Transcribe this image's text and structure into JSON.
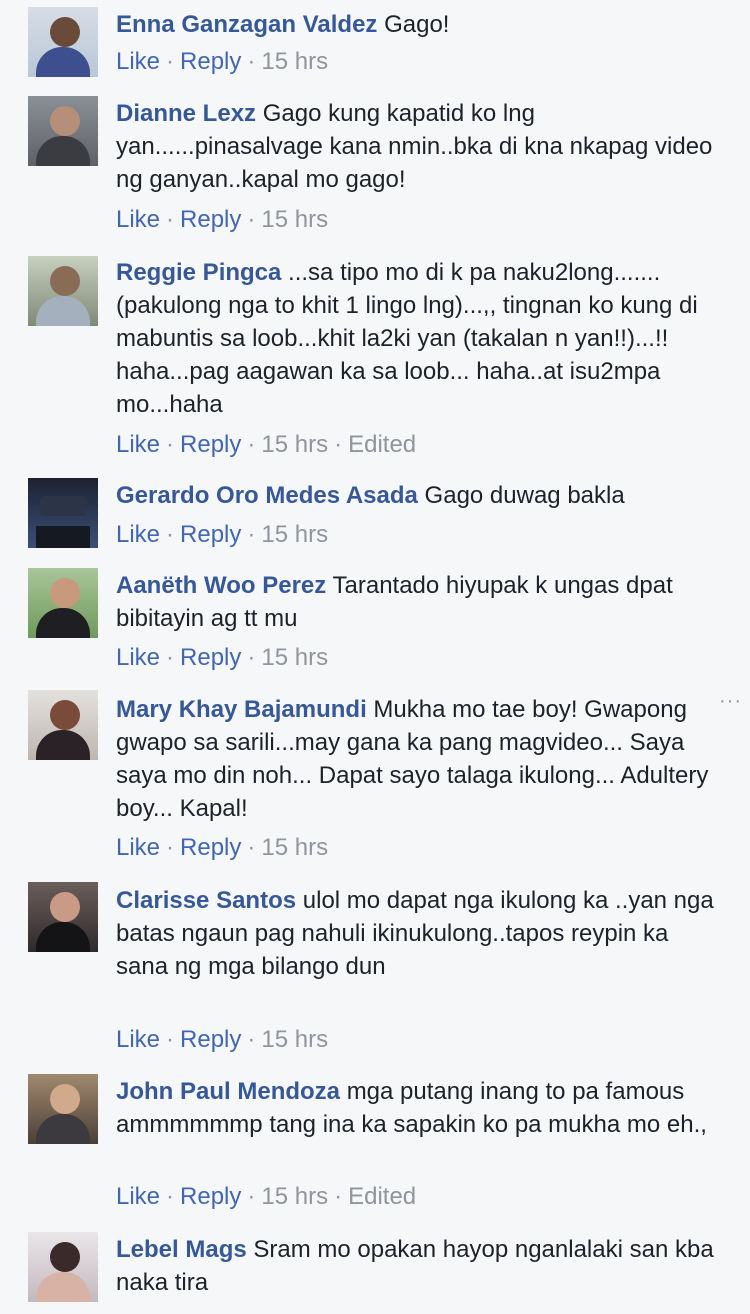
{
  "labels": {
    "like": "Like",
    "reply": "Reply",
    "sep": "·"
  },
  "more_icon": "···",
  "comments": [
    {
      "author": "Enna Ganzagan Valdez",
      "text": "Gago!",
      "time": "15 hrs",
      "edited": ""
    },
    {
      "author": "Dianne Lexz",
      "text": "Gago kung kapatid ko lng yan......pinasalvage kana nmin..bka di kna nkapag video ng ganyan..kapal mo gago!",
      "time": "15 hrs",
      "edited": ""
    },
    {
      "author": "Reggie Pingca",
      "text": "...sa tipo mo di k pa naku2long.......(pakulong nga to khit 1 lingo lng)...,, tingnan ko kung di mabuntis sa loob...khit la2ki yan (takalan n yan!!)...!! haha...pag aagawan ka sa loob... haha..at isu2mpa mo...haha",
      "time": "15 hrs",
      "edited": "Edited"
    },
    {
      "author": "Gerardo Oro Medes Asada",
      "text": "Gago duwag bakla",
      "time": "15 hrs",
      "edited": ""
    },
    {
      "author": "Aanëth Woo Perez",
      "text": "Tarantado hiyupak k ungas dpat bibitayin ag tt mu",
      "time": "15 hrs",
      "edited": ""
    },
    {
      "author": "Mary Khay Bajamundi",
      "text": "Mukha mo tae boy! Gwapong gwapo sa sarili...may gana ka pang magvideo... Saya saya mo din noh... Dapat sayo talaga ikulong... Adultery boy... Kapal!",
      "time": "15 hrs",
      "edited": ""
    },
    {
      "author": "Clarisse Santos",
      "text": "ulol mo dapat nga ikulong ka ..yan nga batas ngaun pag nahuli ikinukulong..tapos reypin ka sana ng mga bilango dun",
      "time": "15 hrs",
      "edited": ""
    },
    {
      "author": "John Paul Mendoza",
      "text": "mga putang inang to pa famous ammmmmmp tang ina ka sapakin ko pa mukha mo eh.,",
      "time": "15 hrs",
      "edited": "Edited"
    },
    {
      "author": "Lebel Mags",
      "text": "Sram mo opakan hayop nganlalaki san kba naka tira",
      "time": "",
      "edited": ""
    }
  ]
}
